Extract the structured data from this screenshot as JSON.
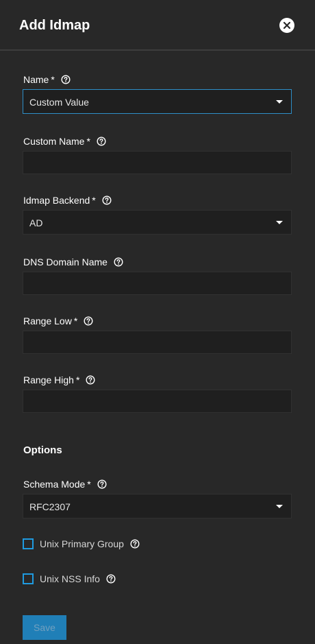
{
  "header": {
    "title": "Add Idmap",
    "close_icon": "close-icon"
  },
  "form": {
    "name": {
      "label": "Name",
      "required": "*",
      "value": "Custom Value"
    },
    "custom_name": {
      "label": "Custom Name",
      "required": "*",
      "value": ""
    },
    "idmap_backend": {
      "label": "Idmap Backend",
      "required": "*",
      "value": "AD"
    },
    "dns_domain_name": {
      "label": "DNS Domain Name",
      "value": ""
    },
    "range_low": {
      "label": "Range Low",
      "required": "*",
      "value": ""
    },
    "range_high": {
      "label": "Range High",
      "required": "*",
      "value": ""
    }
  },
  "options": {
    "title": "Options",
    "schema_mode": {
      "label": "Schema Mode",
      "required": "*",
      "value": "RFC2307"
    },
    "unix_primary_group": {
      "label": "Unix Primary Group",
      "checked": false
    },
    "unix_nss_info": {
      "label": "Unix NSS Info",
      "checked": false
    }
  },
  "actions": {
    "save_label": "Save"
  },
  "colors": {
    "background": "#282828",
    "input_background": "#1f1f1f",
    "accent": "#1f8fd0",
    "focus_border": "#2e8fc9"
  },
  "icons": {
    "help": "help-circle-icon",
    "dropdown": "chevron-down-icon",
    "close": "close-icon"
  }
}
